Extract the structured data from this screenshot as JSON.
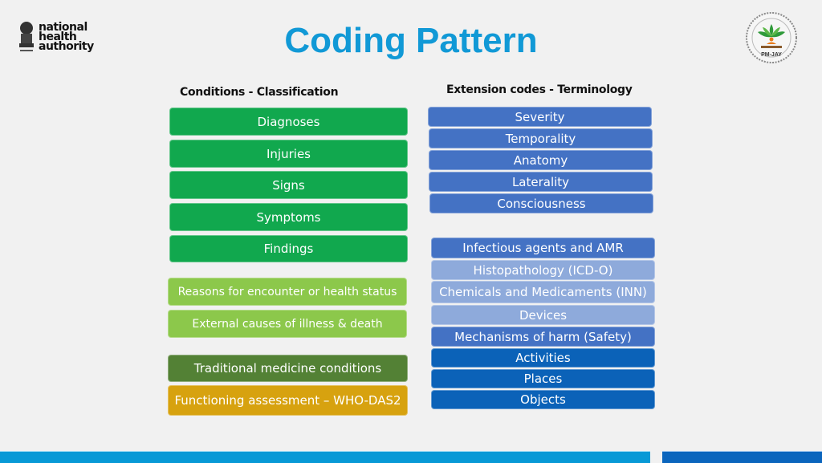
{
  "header": {
    "title": "Coding Pattern",
    "left_logo": {
      "icon": "national-emblem-icon",
      "lines": [
        "national",
        "health",
        "authority"
      ]
    },
    "right_logo": {
      "icon": "pmjay-seal-icon",
      "label": "PM-JAY"
    }
  },
  "conditions": {
    "heading": "Conditions  -  Classification",
    "items": [
      {
        "label": "Diagnoses",
        "color": "#11a84e"
      },
      {
        "label": "Injuries",
        "color": "#11a84e"
      },
      {
        "label": "Signs",
        "color": "#11a84e"
      },
      {
        "label": "Symptoms",
        "color": "#11a84e"
      },
      {
        "label": "Findings",
        "color": "#11a84e"
      },
      {
        "label": "Reasons for encounter or health status",
        "color": "#8cc84b"
      },
      {
        "label": "External causes of illness & death",
        "color": "#8cc84b"
      },
      {
        "label": "Traditional medicine conditions",
        "color": "#538135"
      },
      {
        "label": "Functioning assessment – WHO-DAS2",
        "color": "#d7a20f"
      }
    ]
  },
  "extension_codes": {
    "heading": "Extension codes - Terminology",
    "items": [
      {
        "label": "Severity",
        "color": "#4472c4"
      },
      {
        "label": "Temporality",
        "color": "#4472c4"
      },
      {
        "label": "Anatomy",
        "color": "#4472c4"
      },
      {
        "label": "Laterality",
        "color": "#4472c4"
      },
      {
        "label": "Consciousness",
        "color": "#4472c4"
      },
      {
        "label": "Infectious agents and AMR",
        "color": "#4472c4"
      },
      {
        "label": "Histopathology (ICD-O)",
        "color": "#8eaadb"
      },
      {
        "label": "Chemicals and Medicaments (INN)",
        "color": "#8eaadb"
      },
      {
        "label": "Devices",
        "color": "#8eaadb"
      },
      {
        "label": "Mechanisms of harm (Safety)",
        "color": "#4472c4"
      },
      {
        "label": "Activities",
        "color": "#0b62b8"
      },
      {
        "label": "Places",
        "color": "#0b62b8"
      },
      {
        "label": "Objects",
        "color": "#0b62b8"
      }
    ]
  },
  "footer": {
    "bar_colors": [
      "#0799d6",
      "#0b65bd"
    ]
  }
}
